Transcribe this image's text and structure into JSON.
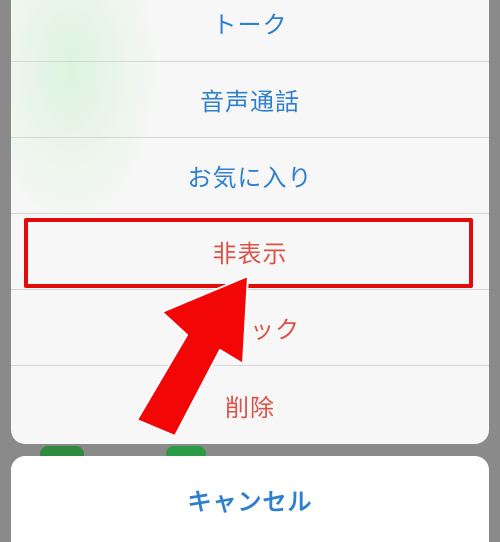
{
  "action_sheet": {
    "items": [
      {
        "label": "トーク",
        "style": "default"
      },
      {
        "label": "音声通話",
        "style": "default"
      },
      {
        "label": "お気に入り",
        "style": "default"
      },
      {
        "label": "非表示",
        "style": "destructive"
      },
      {
        "label": "ブロック",
        "style": "destructive"
      },
      {
        "label": "削除",
        "style": "destructive"
      }
    ],
    "cancel_label": "キャンセル"
  },
  "annotation": {
    "highlight_color": "#e20b0b",
    "arrow_color": "#f20606",
    "highlighted_item": "非表示"
  },
  "colors": {
    "action_text": "#2f7fcf",
    "destructive_text": "#d9534a",
    "sheet_background": "#f7f7f7",
    "backdrop": "#8a8a8a"
  }
}
